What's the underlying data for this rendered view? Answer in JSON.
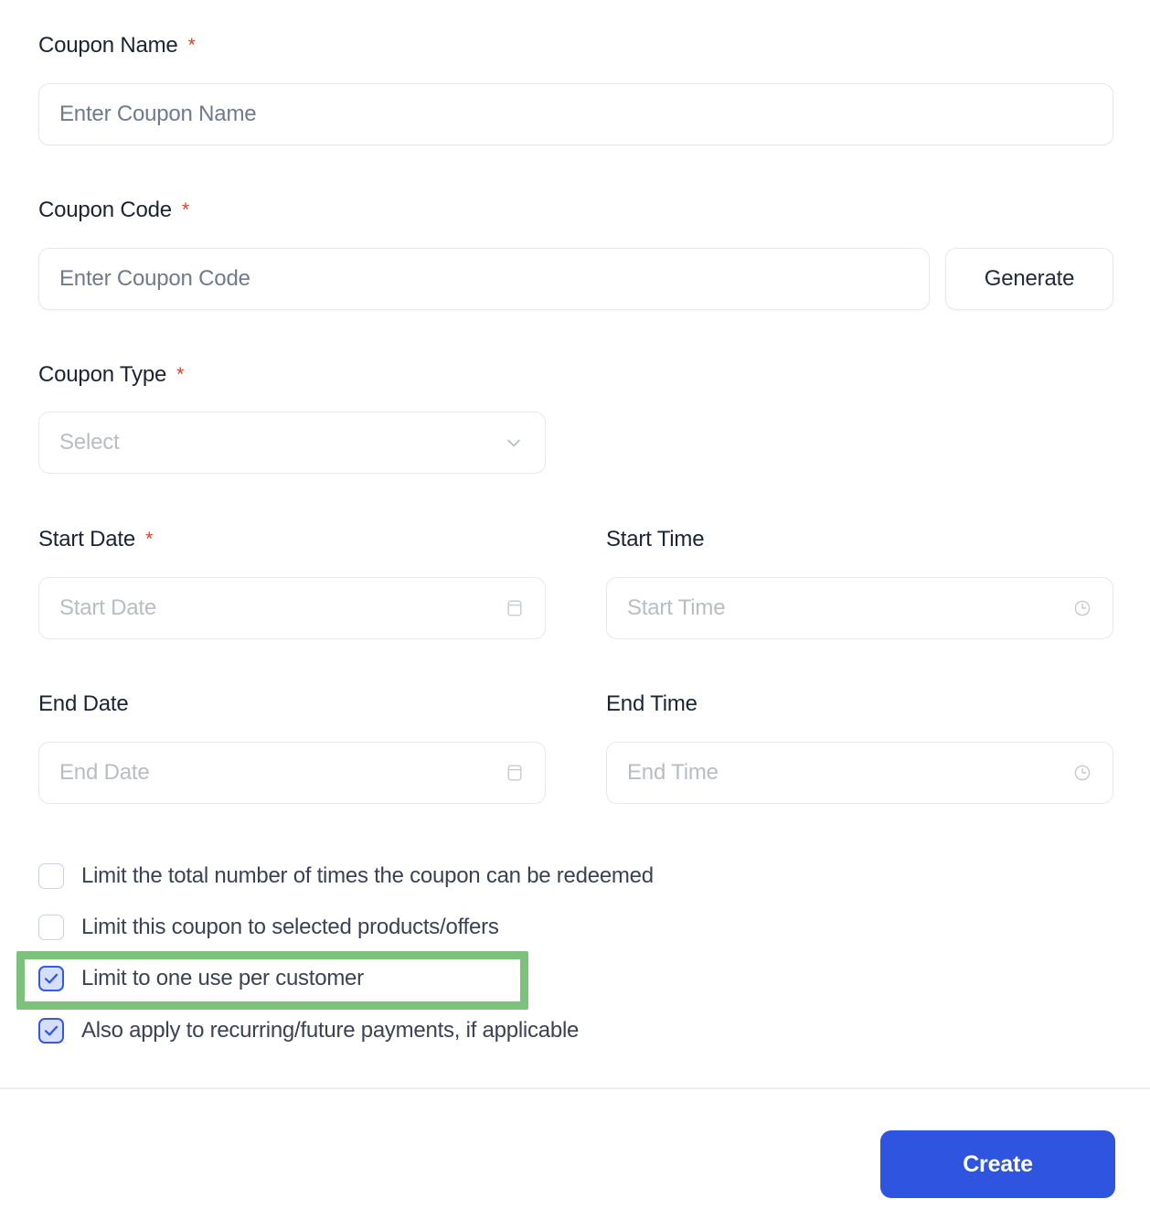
{
  "form": {
    "fields": [
      {
        "label": "Coupon Name",
        "required": true,
        "placeholder": "Enter Coupon Name",
        "value": ""
      },
      {
        "label": "Coupon Code",
        "required": true,
        "placeholder": "Enter Coupon Code",
        "value": ""
      },
      {
        "label": "Coupon Type",
        "required": true,
        "placeholder": "Select",
        "value": ""
      },
      {
        "label": "Start Date",
        "required": true,
        "placeholder": "Start Date",
        "value": ""
      },
      {
        "label": "Start Time",
        "required": false,
        "placeholder": "Start Time",
        "value": ""
      },
      {
        "label": "End Date",
        "required": false,
        "placeholder": "End Date",
        "value": ""
      },
      {
        "label": "End Time",
        "required": false,
        "placeholder": "End Time",
        "value": ""
      }
    ],
    "required_marker": "*",
    "generate_button": "Generate",
    "icons": {
      "select": "chevron-down-icon",
      "date": "calendar-icon",
      "time": "clock-icon"
    }
  },
  "checkboxes": [
    {
      "label": "Limit the total number of times the coupon can be redeemed",
      "checked": false,
      "highlighted": false
    },
    {
      "label": "Limit this coupon to selected products/offers",
      "checked": false,
      "highlighted": false
    },
    {
      "label": "Limit to one use per customer",
      "checked": true,
      "highlighted": true
    },
    {
      "label": "Also apply to recurring/future payments, if applicable",
      "checked": true,
      "highlighted": false
    }
  ],
  "footer": {
    "submit_label": "Create"
  },
  "colors": {
    "primary": "#2f55e0",
    "checkbox_checked_border": "#3758e0",
    "checkbox_checked_fill": "#d5defb",
    "required_asterisk": "#cf4428",
    "highlight_green": "#7cc17c",
    "label_text": "#1c2333",
    "placeholder_text": "#707a8e",
    "border": "#e7e8ed"
  }
}
